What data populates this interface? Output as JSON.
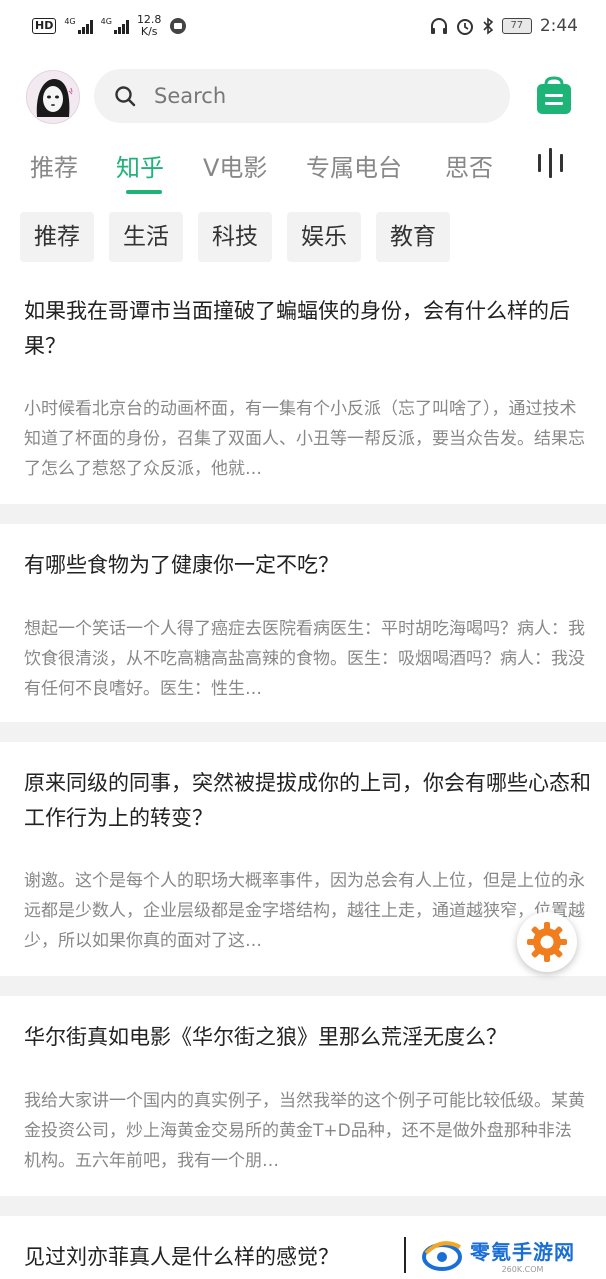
{
  "status_bar": {
    "hd": "HD",
    "net1": "4G",
    "net2": "4G",
    "speed_value": "12.8",
    "speed_unit": "K/s",
    "battery": "77",
    "time": "2:44"
  },
  "header": {
    "search_placeholder": "Search"
  },
  "tabs": [
    {
      "label": "推荐"
    },
    {
      "label": "知乎"
    },
    {
      "label": "V电影"
    },
    {
      "label": "专属电台"
    },
    {
      "label": "思否"
    }
  ],
  "active_tab": "知乎",
  "chips": [
    {
      "label": "推荐"
    },
    {
      "label": "生活"
    },
    {
      "label": "科技"
    },
    {
      "label": "娱乐"
    },
    {
      "label": "教育"
    }
  ],
  "feed": [
    {
      "title": "如果我在哥谭市当面撞破了蝙蝠侠的身份，会有什么样的后果？",
      "excerpt": "小时候看北京台的动画杯面，有一集有个小反派（忘了叫啥了），通过技术知道了杯面的身份，召集了双面人、小丑等一帮反派，要当众告发。结果忘了怎么了惹怒了众反派，他就…"
    },
    {
      "title": "有哪些食物为了健康你一定不吃？",
      "excerpt": "想起一个笑话一个人得了癌症去医院看病医生：平时胡吃海喝吗？病人：我饮食很清淡，从不吃高糖高盐高辣的食物。医生：吸烟喝酒吗？病人：我没有任何不良嗜好。医生：性生…"
    },
    {
      "title": "原来同级的同事，突然被提拔成你的上司，你会有哪些心态和工作行为上的转变？",
      "excerpt": "谢邀。这个是每个人的职场大概率事件，因为总会有人上位，但是上位的永远都是少数人，企业层级都是金字塔结构，越往上走，通道越狭窄，位置越少，所以如果你真的面对了这…"
    },
    {
      "title": "华尔街真如电影《华尔街之狼》里那么荒淫无度么？",
      "excerpt": "我给大家讲一个国内的真实例子，当然我举的这个例子可能比较低级。某黄金投资公司，炒上海黄金交易所的黄金T+D品种，还不是做外盘那种非法机构。五六年前吧，我有一个朋…"
    },
    {
      "title": "见过刘亦菲真人是什么样的感觉？",
      "excerpt": ""
    }
  ],
  "watermark": {
    "name": "零氪手游网",
    "url": "260K.COM"
  },
  "colors": {
    "accent": "#1eb478",
    "fab_icon": "#f07d1e",
    "watermark_blue": "#1a6fd6"
  },
  "icons": {
    "search": "search-icon",
    "bag": "bag-icon",
    "more": "equalizer-icon",
    "fab": "gear-icon"
  }
}
